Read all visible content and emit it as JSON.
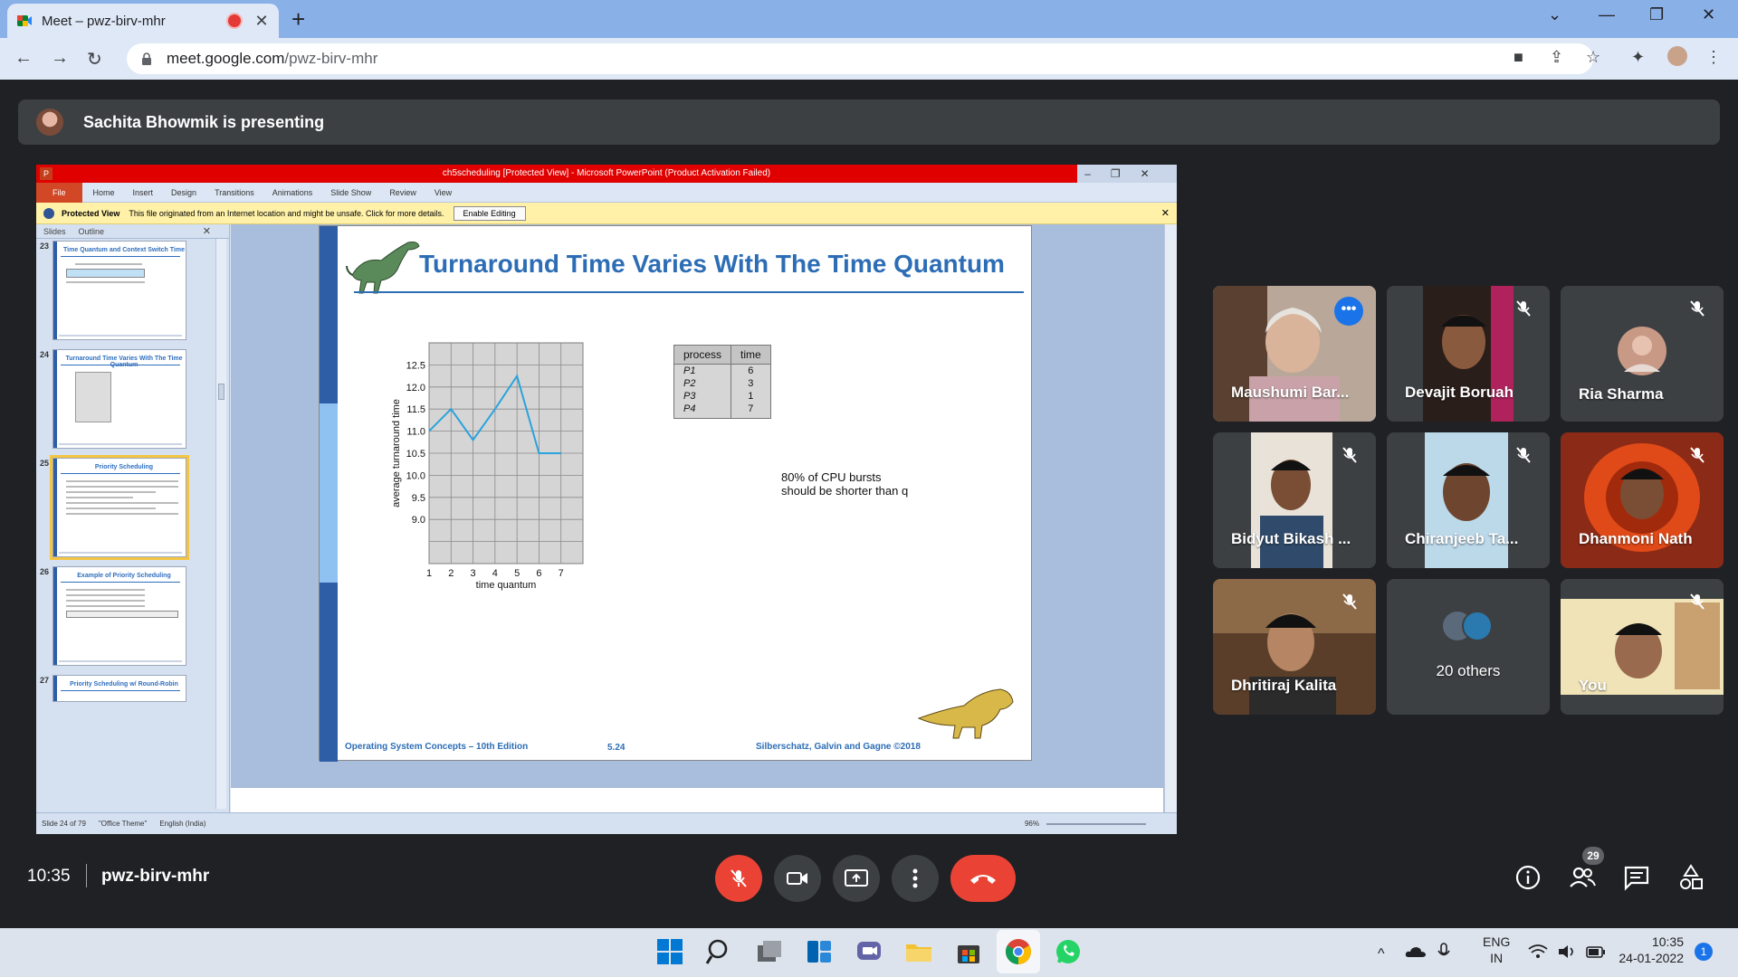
{
  "browser": {
    "tab_title": "Meet – pwz-birv-mhr",
    "url_host": "meet.google.com",
    "url_path": "/pwz-birv-mhr",
    "new_tab": "+",
    "close_tab": "✕"
  },
  "meet": {
    "presenting_banner": "Sachita Bhowmik is presenting",
    "time": "10:35",
    "meeting_code": "pwz-birv-mhr",
    "people_count": "29",
    "participants": [
      {
        "name": "Maushumi Bar...",
        "speaking": true,
        "muted": false
      },
      {
        "name": "Devajit Boruah",
        "speaking": false,
        "muted": true
      },
      {
        "name": "Ria Sharma",
        "speaking": false,
        "muted": true
      },
      {
        "name": "Bidyut Bikash ...",
        "speaking": false,
        "muted": true
      },
      {
        "name": "Chiranjeeb Ta...",
        "speaking": false,
        "muted": true
      },
      {
        "name": "Dhanmoni Nath",
        "speaking": false,
        "muted": true
      },
      {
        "name": "Dhritiraj Kalita",
        "speaking": false,
        "muted": true
      },
      {
        "name": "20 others",
        "speaking": false,
        "muted": false
      },
      {
        "name": "You",
        "speaking": false,
        "muted": true
      }
    ]
  },
  "powerpoint": {
    "window_title": "ch5scheduling [Protected View] - Microsoft PowerPoint (Product Activation Failed)",
    "ribbon_tabs": [
      "File",
      "Home",
      "Insert",
      "Design",
      "Transitions",
      "Animations",
      "Slide Show",
      "Review",
      "View"
    ],
    "protected_label": "Protected View",
    "protected_message": "This file originated from an Internet location and might be unsafe. Click for more details.",
    "enable_editing": "Enable Editing",
    "panel_tabs": [
      "Slides",
      "Outline"
    ],
    "thumbnails": [
      {
        "num": "23",
        "title": "Time Quantum and Context Switch Time",
        "selected": false
      },
      {
        "num": "24",
        "title": "Turnaround Time Varies With The Time Quantum",
        "selected": false
      },
      {
        "num": "25",
        "title": "Priority Scheduling",
        "selected": true
      },
      {
        "num": "26",
        "title": "Example of Priority Scheduling",
        "selected": false
      },
      {
        "num": "27",
        "title": "Priority Scheduling w/ Round-Robin",
        "selected": false
      }
    ],
    "status": {
      "slide": "Slide 24 of 79",
      "theme": "\"Office Theme\"",
      "language": "English (India)",
      "zoom": "96%"
    }
  },
  "slide": {
    "title": "Turnaround Time Varies With The Time Quantum",
    "note": "80% of CPU bursts\nshould be shorter than q",
    "footer_left": "Operating System Concepts – 10th Edition",
    "footer_mid": "5.24",
    "footer_right": "Silberschatz, Galvin and Gagne ©2018",
    "table": {
      "headers": [
        "process",
        "time"
      ],
      "rows": [
        {
          "p": "P1",
          "t": "6"
        },
        {
          "p": "P2",
          "t": "3"
        },
        {
          "p": "P3",
          "t": "1"
        },
        {
          "p": "P4",
          "t": "7"
        }
      ]
    }
  },
  "chart_data": {
    "type": "line",
    "x": [
      1,
      2,
      3,
      4,
      5,
      6,
      7
    ],
    "values": [
      11.0,
      11.5,
      10.8,
      11.5,
      12.25,
      10.5,
      10.5
    ],
    "xlabel": "time quantum",
    "ylabel": "average turnaround time",
    "yticks": [
      "12.5",
      "12.0",
      "11.5",
      "11.0",
      "10.5",
      "10.0",
      "9.5",
      "9.0"
    ],
    "xticks": [
      "1",
      "2",
      "3",
      "4",
      "5",
      "6",
      "7"
    ],
    "ylim": [
      8.0,
      13.0
    ],
    "xlim": [
      1,
      8
    ],
    "grid": true,
    "color": "#29a3dd"
  },
  "taskbar": {
    "lang_top": "ENG",
    "lang_bottom": "IN",
    "clock_time": "10:35",
    "clock_date": "24-01-2022",
    "notifications": "1"
  }
}
